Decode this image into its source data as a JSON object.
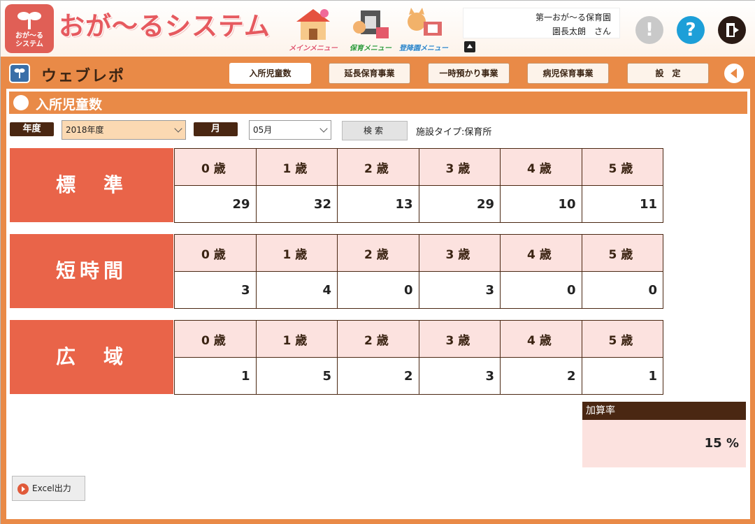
{
  "header": {
    "logo_text": "おが～る\nシステム",
    "app_title": "おが～るシステム",
    "menus": [
      {
        "label": "メインメニュー",
        "icon": "house-icon"
      },
      {
        "label": "保育メニュー",
        "icon": "calendar-child-icon"
      },
      {
        "label": "登降園メニュー",
        "icon": "cat-camera-icon"
      }
    ],
    "user": {
      "facility": "第一おが～る保育園",
      "name": "園長太朗　さん"
    },
    "icons": [
      "alert-icon",
      "help-icon",
      "logout-icon"
    ]
  },
  "subnav": {
    "title": "ウェブレポ",
    "tabs": [
      "入所児童数",
      "延長保育事業",
      "一時預かり事業",
      "病児保育事業",
      "設　定"
    ],
    "active_tab": 0
  },
  "section": {
    "title": "入所児童数"
  },
  "filters": {
    "year_label": "年度",
    "year_value": "2018年度",
    "month_label": "月",
    "month_value": "05月",
    "search_label": "検索",
    "facility_type": "施設タイプ:保育所"
  },
  "tables": [
    {
      "category": "標　準",
      "ages": [
        "0 歳",
        "1 歳",
        "2 歳",
        "3 歳",
        "4 歳",
        "5 歳"
      ],
      "values": [
        "29",
        "32",
        "13",
        "29",
        "10",
        "11"
      ]
    },
    {
      "category": "短時間",
      "ages": [
        "0 歳",
        "1 歳",
        "2 歳",
        "3 歳",
        "4 歳",
        "5 歳"
      ],
      "values": [
        "3",
        "4",
        "0",
        "3",
        "0",
        "0"
      ]
    },
    {
      "category": "広　域",
      "ages": [
        "0 歳",
        "1 歳",
        "2 歳",
        "3 歳",
        "4 歳",
        "5 歳"
      ],
      "values": [
        "1",
        "5",
        "2",
        "3",
        "2",
        "1"
      ]
    }
  ],
  "rate": {
    "label": "加算率",
    "value": "15 %"
  },
  "export": {
    "label": "Excel出力"
  },
  "colors": {
    "accent": "#e98a47",
    "category_bg": "#e96449",
    "header_bg": "#fce2df",
    "dark": "#4a2712"
  }
}
